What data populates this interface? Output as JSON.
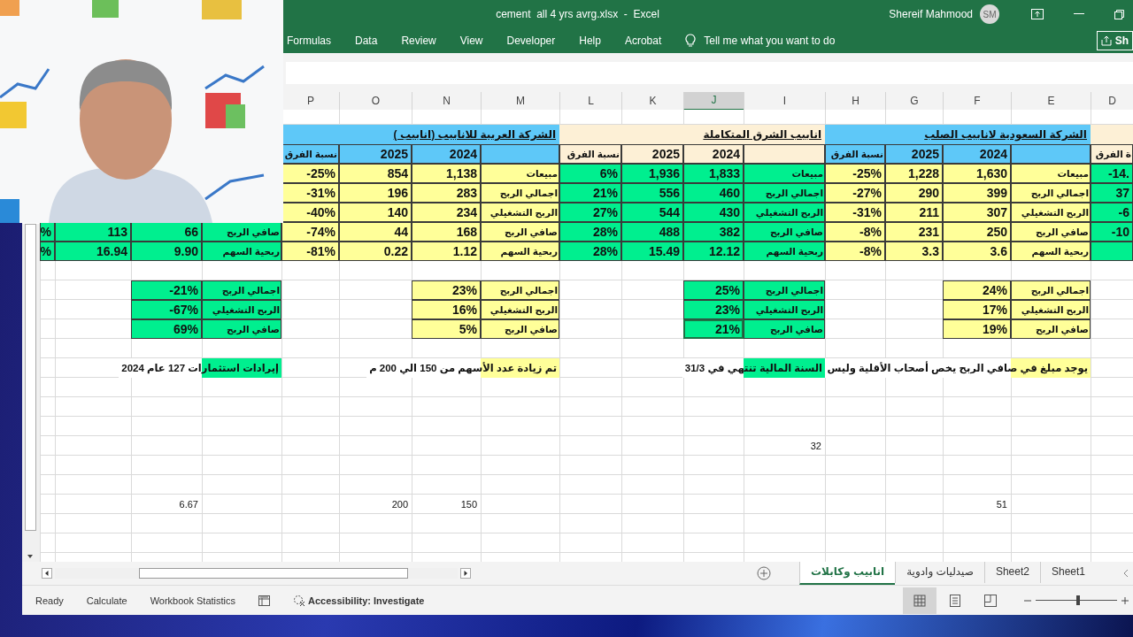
{
  "window": {
    "title": "cement  all 4 yrs avrg.xlsx  -  Excel",
    "user": "Shereif Mahmood",
    "initials": "SM"
  },
  "ribbon_tabs": {
    "formulas": {
      "label": "Formulas",
      "selected": false
    },
    "data": {
      "label": "Data",
      "selected": false
    },
    "review": {
      "label": "Review",
      "selected": false
    },
    "view": {
      "label": "View",
      "selected": false
    },
    "developer": {
      "label": "Developer",
      "selected": false
    },
    "help": {
      "label": "Help",
      "selected": false
    },
    "acrobat": {
      "label": "Acrobat",
      "selected": false
    }
  },
  "tell_me": {
    "placeholder": "Tell me what you want to do"
  },
  "share_button": "Sh",
  "columns": [
    {
      "label": "D",
      "selected": false
    },
    {
      "label": "E",
      "selected": false
    },
    {
      "label": "F",
      "selected": false
    },
    {
      "label": "G",
      "selected": false
    },
    {
      "label": "H",
      "selected": false
    },
    {
      "label": "I",
      "selected": false
    },
    {
      "label": "J",
      "selected": true
    },
    {
      "label": "K",
      "selected": false
    },
    {
      "label": "L",
      "selected": false
    },
    {
      "label": "M",
      "selected": false
    },
    {
      "label": "N",
      "selected": false
    },
    {
      "label": "O",
      "selected": false
    },
    {
      "label": "P",
      "selected": false
    }
  ],
  "rows": [
    {},
    {
      "cells": [
        {
          "color": "#fdf0d6",
          "kind": "title"
        },
        {
          "t": "الشركة السعودية لانابيب الصلب",
          "color": "#5ec8f8",
          "kind": "title"
        },
        null,
        null,
        null,
        {
          "t": "انابيب الشرق المتكاملة",
          "color": "#fdf0d6",
          "kind": "title"
        },
        null,
        null,
        null,
        {
          "t": "الشركة العربية للانابيب  (انابيب )",
          "color": "#5ec8f8",
          "kind": "title"
        },
        null,
        null,
        null
      ]
    },
    {
      "cells": [
        {
          "t": "ة الفرق",
          "color": "#fdf0d6",
          "kind": "label"
        },
        {
          "color": "#5ec8f8"
        },
        {
          "t": "2024",
          "color": "#5ec8f8",
          "kind": "head"
        },
        {
          "t": "2025",
          "color": "#5ec8f8",
          "kind": "head"
        },
        {
          "t": "نسبة الفرق",
          "color": "#5ec8f8",
          "kind": "label"
        },
        {
          "color": "#fdf0d6"
        },
        {
          "t": "2024",
          "color": "#fdf0d6",
          "kind": "head"
        },
        {
          "t": "2025",
          "color": "#fdf0d6",
          "kind": "head"
        },
        {
          "t": "نسبة الفرق",
          "color": "#fdf0d6",
          "kind": "label"
        },
        {
          "color": "#5ec8f8"
        },
        {
          "t": "2024",
          "color": "#5ec8f8",
          "kind": "head"
        },
        {
          "t": "2025",
          "color": "#5ec8f8",
          "kind": "head"
        },
        {
          "t": "نسبة الفرق",
          "color": "#5ec8f8",
          "kind": "label"
        }
      ]
    },
    {
      "cells": [
        {
          "t": "-14.",
          "color": "#00ef8f",
          "kind": "num"
        },
        {
          "t": "مبيعات",
          "color": "#ffff99",
          "kind": "label"
        },
        {
          "t": "1,630",
          "color": "#ffff99",
          "kind": "num"
        },
        {
          "t": "1,228",
          "color": "#ffff99",
          "kind": "num"
        },
        {
          "t": "-25%",
          "color": "#ffff99",
          "kind": "num"
        },
        {
          "t": "مبيعات",
          "color": "#00ef8f",
          "kind": "label"
        },
        {
          "t": "1,833",
          "color": "#00ef8f",
          "kind": "num"
        },
        {
          "t": "1,936",
          "color": "#00ef8f",
          "kind": "num"
        },
        {
          "t": "6%",
          "color": "#00ef8f",
          "kind": "num"
        },
        {
          "t": "مبيعات",
          "color": "#ffff99",
          "kind": "label"
        },
        {
          "t": "1,138",
          "color": "#ffff99",
          "kind": "num"
        },
        {
          "t": "854",
          "color": "#ffff99",
          "kind": "num"
        },
        {
          "t": "-25%",
          "color": "#ffff99",
          "kind": "num"
        }
      ]
    },
    {
      "cells": [
        {
          "t": "37",
          "color": "#00ef8f",
          "kind": "num"
        },
        {
          "t": "اجمالي الربح",
          "color": "#ffff99",
          "kind": "label"
        },
        {
          "t": "399",
          "color": "#ffff99",
          "kind": "num"
        },
        {
          "t": "290",
          "color": "#ffff99",
          "kind": "num"
        },
        {
          "t": "-27%",
          "color": "#ffff99",
          "kind": "num"
        },
        {
          "t": "اجمالي الربح",
          "color": "#00ef8f",
          "kind": "label"
        },
        {
          "t": "460",
          "color": "#00ef8f",
          "kind": "num"
        },
        {
          "t": "556",
          "color": "#00ef8f",
          "kind": "num"
        },
        {
          "t": "21%",
          "color": "#00ef8f",
          "kind": "num"
        },
        {
          "t": "اجمالي الربح",
          "color": "#ffff99",
          "kind": "label"
        },
        {
          "t": "283",
          "color": "#ffff99",
          "kind": "num"
        },
        {
          "t": "196",
          "color": "#ffff99",
          "kind": "num"
        },
        {
          "t": "-31%",
          "color": "#ffff99",
          "kind": "num"
        }
      ]
    },
    {
      "cells": [
        {
          "t": "-6",
          "color": "#00ef8f",
          "kind": "num"
        },
        {
          "t": "الربح التشغيلي",
          "color": "#ffff99",
          "kind": "label"
        },
        {
          "t": "307",
          "color": "#ffff99",
          "kind": "num"
        },
        {
          "t": "211",
          "color": "#ffff99",
          "kind": "num"
        },
        {
          "t": "-31%",
          "color": "#ffff99",
          "kind": "num"
        },
        {
          "t": "الربح التشغيلي",
          "color": "#00ef8f",
          "kind": "label"
        },
        {
          "t": "430",
          "color": "#00ef8f",
          "kind": "num"
        },
        {
          "t": "544",
          "color": "#00ef8f",
          "kind": "num"
        },
        {
          "t": "27%",
          "color": "#00ef8f",
          "kind": "num"
        },
        {
          "t": "الربح التشغيلي",
          "color": "#ffff99",
          "kind": "label"
        },
        {
          "t": "234",
          "color": "#ffff99",
          "kind": "num"
        },
        {
          "t": "140",
          "color": "#ffff99",
          "kind": "num"
        },
        {
          "t": "-40%",
          "color": "#ffff99",
          "kind": "num"
        }
      ]
    },
    {
      "cells": [
        {
          "t": "-10",
          "color": "#00ef8f",
          "kind": "num"
        },
        {
          "t": "صافي الربح",
          "color": "#ffff99",
          "kind": "label"
        },
        {
          "t": "250",
          "color": "#ffff99",
          "kind": "num"
        },
        {
          "t": "231",
          "color": "#ffff99",
          "kind": "num"
        },
        {
          "t": "-8%",
          "color": "#ffff99",
          "kind": "num"
        },
        {
          "t": "صافي الربح",
          "color": "#00ef8f",
          "kind": "label"
        },
        {
          "t": "382",
          "color": "#00ef8f",
          "kind": "num"
        },
        {
          "t": "488",
          "color": "#00ef8f",
          "kind": "num"
        },
        {
          "t": "28%",
          "color": "#00ef8f",
          "kind": "num"
        },
        {
          "t": "صافي الربح",
          "color": "#ffff99",
          "kind": "label"
        },
        {
          "t": "168",
          "color": "#ffff99",
          "kind": "num"
        },
        {
          "t": "44",
          "color": "#ffff99",
          "kind": "num"
        },
        {
          "t": "-74%",
          "color": "#ffff99",
          "kind": "num"
        },
        {
          "t": "صافي الربح",
          "color": "#00ef8f",
          "kind": "label"
        },
        {
          "t": "66",
          "color": "#00ef8f",
          "kind": "num"
        },
        {
          "t": "113",
          "color": "#00ef8f",
          "kind": "num"
        },
        {
          "t": "%",
          "color": "#00ef8f",
          "kind": "num"
        }
      ]
    },
    {
      "cells": [
        {
          "color": "#00ef8f"
        },
        {
          "t": "ربحية السهم",
          "color": "#ffff99",
          "kind": "label"
        },
        {
          "t": "3.6",
          "color": "#ffff99",
          "kind": "num"
        },
        {
          "t": "3.3",
          "color": "#ffff99",
          "kind": "num"
        },
        {
          "t": "-8%",
          "color": "#ffff99",
          "kind": "num"
        },
        {
          "t": "ربحية السهم",
          "color": "#00ef8f",
          "kind": "label"
        },
        {
          "t": "12.12",
          "color": "#00ef8f",
          "kind": "num"
        },
        {
          "t": "15.49",
          "color": "#00ef8f",
          "kind": "num"
        },
        {
          "t": "28%",
          "color": "#00ef8f",
          "kind": "num"
        },
        {
          "t": "ربحية السهم",
          "color": "#ffff99",
          "kind": "label"
        },
        {
          "t": "1.12",
          "color": "#ffff99",
          "kind": "num"
        },
        {
          "t": "0.22",
          "color": "#ffff99",
          "kind": "num"
        },
        {
          "t": "-81%",
          "color": "#ffff99",
          "kind": "num"
        },
        {
          "t": "ربحية السهم",
          "color": "#00ef8f",
          "kind": "label"
        },
        {
          "t": "9.90",
          "color": "#00ef8f",
          "kind": "num"
        },
        {
          "t": "16.94",
          "color": "#00ef8f",
          "kind": "num"
        },
        {
          "t": "%",
          "color": "#00ef8f",
          "kind": "num"
        }
      ]
    },
    {},
    {
      "cells": [
        null,
        {
          "t": "اجمالي الربح",
          "color": "#ffff99",
          "kind": "label"
        },
        {
          "t": "24%",
          "color": "#ffff99",
          "kind": "num"
        },
        null,
        null,
        {
          "t": "اجمالي الربح",
          "color": "#00ef8f",
          "kind": "label"
        },
        {
          "t": "25%",
          "color": "#00ef8f",
          "kind": "num"
        },
        null,
        null,
        {
          "t": "اجمالي الربح",
          "color": "#ffff99",
          "kind": "label"
        },
        {
          "t": "23%",
          "color": "#ffff99",
          "kind": "num"
        },
        null,
        null,
        {
          "t": "اجمالي الربح",
          "color": "#00ef8f",
          "kind": "label"
        },
        {
          "t": "-21%",
          "color": "#00ef8f",
          "kind": "num"
        }
      ]
    },
    {
      "cells": [
        null,
        {
          "t": "الربح التشغيلي",
          "color": "#ffff99",
          "kind": "label"
        },
        {
          "t": "17%",
          "color": "#ffff99",
          "kind": "num"
        },
        null,
        null,
        {
          "t": "الربح التشغيلي",
          "color": "#00ef8f",
          "kind": "label"
        },
        {
          "t": "23%",
          "color": "#00ef8f",
          "kind": "num"
        },
        null,
        null,
        {
          "t": "الربح التشغيلي",
          "color": "#ffff99",
          "kind": "label"
        },
        {
          "t": "16%",
          "color": "#ffff99",
          "kind": "num"
        },
        null,
        null,
        {
          "t": "الربح التشغيلي",
          "color": "#00ef8f",
          "kind": "label"
        },
        {
          "t": "-67%",
          "color": "#00ef8f",
          "kind": "num"
        }
      ]
    },
    {
      "cells": [
        null,
        {
          "t": "صافي الربح",
          "color": "#ffff99",
          "kind": "label"
        },
        {
          "t": "19%",
          "color": "#ffff99",
          "kind": "num"
        },
        null,
        null,
        {
          "t": "صافي الربح",
          "color": "#00ef8f",
          "kind": "label"
        },
        {
          "t": "21%",
          "color": "#00ef8f",
          "kind": "num",
          "selected": true
        },
        null,
        null,
        {
          "t": "صافي الربح",
          "color": "#ffff99",
          "kind": "label"
        },
        {
          "t": "5%",
          "color": "#ffff99",
          "kind": "num"
        },
        null,
        null,
        {
          "t": "صافي الربح",
          "color": "#00ef8f",
          "kind": "label"
        },
        {
          "t": "69%",
          "color": "#00ef8f",
          "kind": "num"
        }
      ]
    },
    {},
    {
      "cells": [
        null,
        {
          "t": "يوجد مبلغ في صافي الربح يخص أصحاب الأقلية وليس",
          "color": "#ffff99",
          "kind": "note"
        },
        null,
        null,
        null,
        {
          "t": "السنة المالية تنتهي في 31/3",
          "color": "#00ef8f",
          "kind": "note"
        },
        null,
        null,
        null,
        {
          "t": "تم زيادة عدد الأسهم من 150 الي 200 م",
          "color": "#ffff99",
          "kind": "note"
        },
        null,
        null,
        null,
        {
          "t": "إيرادات استثمارات 127 عام 2024",
          "color": "#00ef8f",
          "kind": "note"
        }
      ]
    },
    {},
    {},
    {},
    {
      "cells": [
        null,
        null,
        null,
        null,
        null,
        {
          "t": "32",
          "kind": "plain"
        }
      ]
    },
    {},
    {},
    {
      "cells": [
        null,
        null,
        {
          "t": "51",
          "kind": "plain"
        },
        null,
        null,
        null,
        null,
        null,
        null,
        null,
        {
          "t": "150",
          "kind": "plain"
        },
        {
          "t": "200",
          "kind": "plain"
        },
        null,
        null,
        {
          "t": "6.67",
          "kind": "plain"
        }
      ]
    },
    {},
    {},
    {}
  ],
  "sheet_tabs": [
    {
      "label": "Sheet1",
      "selected": false
    },
    {
      "label": "Sheet2",
      "selected": false
    },
    {
      "label": "صيدليات وادوية",
      "selected": false
    },
    {
      "label": "انابيب وكابلات",
      "selected": true
    }
  ],
  "status_bar": {
    "mode": "Ready",
    "calculate": "Calculate",
    "statistics": "Workbook Statistics",
    "accessibility": "Accessibility: Investigate",
    "zoom": {
      "level": 0.52
    }
  }
}
